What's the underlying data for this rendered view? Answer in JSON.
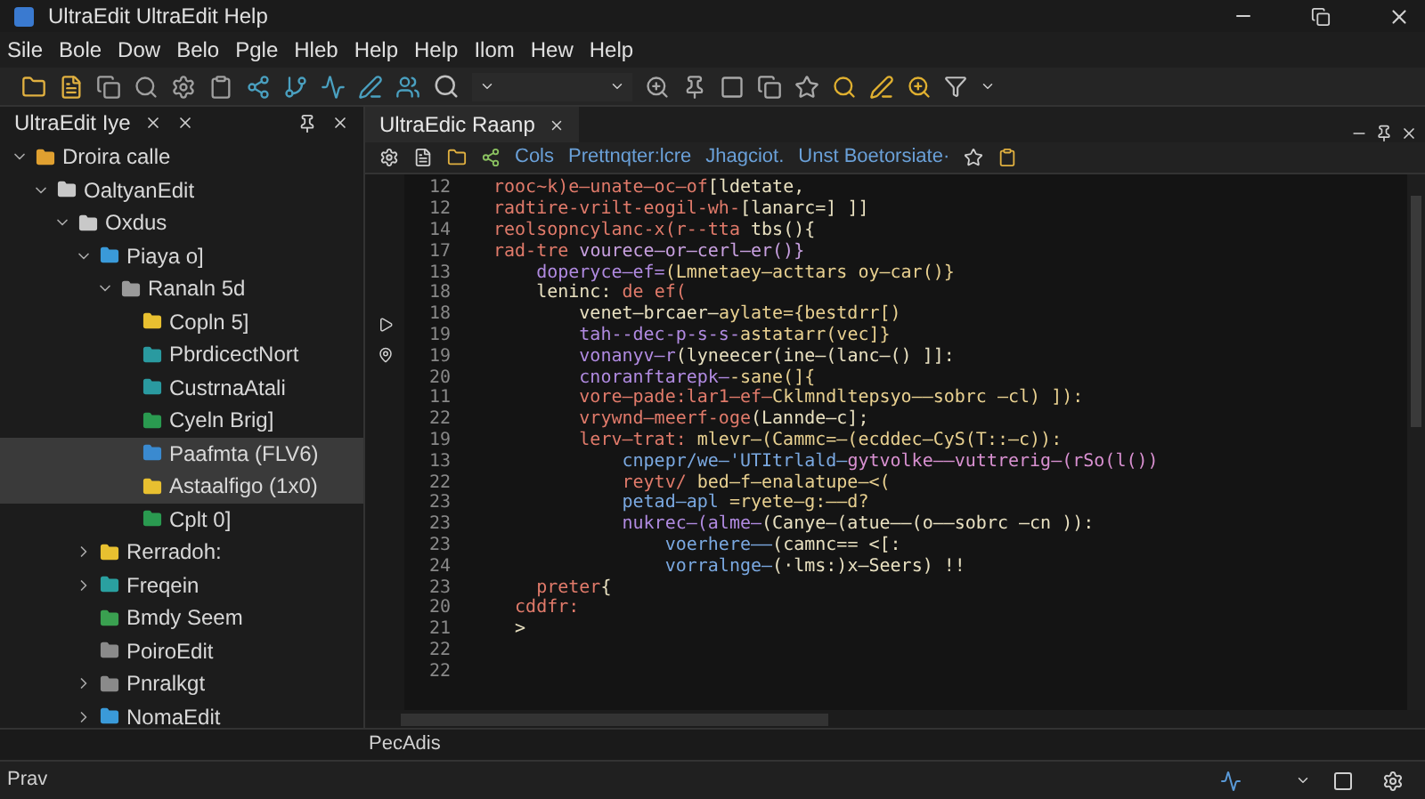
{
  "window": {
    "title": "UltraEdit UltraEdit Help"
  },
  "menu": [
    "Sile",
    "Bole",
    "Dow",
    "Belo",
    "Pgle",
    "Hleb",
    "Help",
    "Help",
    "Ilom",
    "Hew",
    "Help"
  ],
  "explorer": {
    "tab": "UltraEdit Iye",
    "tree": [
      {
        "label": "Droira calle",
        "color": "#e0a030",
        "expanded": true,
        "selected": false,
        "children": [
          {
            "label": "OaltyanEdit",
            "color": "#c8c8c8",
            "expanded": true,
            "selected": false,
            "children": [
              {
                "label": "Oxdus",
                "color": "#c8c8c8",
                "expanded": true,
                "selected": false,
                "children": [
                  {
                    "label": "Piaya o]",
                    "color": "#3a9ad9",
                    "expanded": true,
                    "selected": false,
                    "children": [
                      {
                        "label": "Ranaln 5d",
                        "color": "#9a9a9a",
                        "expanded": true,
                        "selected": false,
                        "children": [
                          {
                            "label": "Copln 5]",
                            "color": "#e8c030",
                            "selected": false
                          },
                          {
                            "label": "PbrdicectNort",
                            "color": "#2a9aa0",
                            "selected": false
                          },
                          {
                            "label": "CustrnaAtali",
                            "color": "#2a9aa0",
                            "selected": false
                          },
                          {
                            "label": "Cyeln Brig]",
                            "color": "#2a9a50",
                            "selected": false
                          },
                          {
                            "label": "Paafmta (FLV6)",
                            "color": "#3a8ad0",
                            "selected": true
                          },
                          {
                            "label": "Astaalfigo (1x0)",
                            "color": "#e8c030",
                            "selected": true
                          },
                          {
                            "label": "Cplt 0]",
                            "color": "#2a9a50",
                            "selected": false
                          }
                        ]
                      }
                    ]
                  },
                  {
                    "label": "Rerradoh:",
                    "color": "#e8c030",
                    "expanded": false,
                    "selected": false
                  },
                  {
                    "label": "Freqein",
                    "color": "#2aa0a0",
                    "expanded": false,
                    "selected": false
                  },
                  {
                    "label": "Bmdy Seem",
                    "color": "#3aa050",
                    "selected": false
                  },
                  {
                    "label": "PoiroEdit",
                    "color": "#8a8a8a",
                    "selected": false
                  },
                  {
                    "label": "Pnralkgt",
                    "color": "#8a8a8a",
                    "expanded": false,
                    "selected": false
                  },
                  {
                    "label": "NomaEdit",
                    "color": "#3a9ad9",
                    "expanded": false,
                    "selected": false
                  }
                ]
              }
            ]
          }
        ]
      }
    ]
  },
  "editor": {
    "tab": "UltraEdic Raanp",
    "breadcrumbs": [
      "Cols",
      "Prettnqter:lcre",
      "Jhagciot.",
      "Unst Boetorsiate·"
    ],
    "lines": [
      {
        "number": "12",
        "segments": [
          {
            "text": "rooc~k)e–unate–oc–of",
            "color": "#e07a6a"
          },
          {
            "text": "[ldetate,",
            "color": "#e8e0c0"
          }
        ]
      },
      {
        "number": "12",
        "segments": [
          {
            "text": "radtire-vrilt-eogil-wh-",
            "color": "#e07a6a"
          },
          {
            "text": "[lanarc=] ]]",
            "color": "#e8e0c0"
          }
        ]
      },
      {
        "number": "14",
        "segments": [
          {
            "text": "reolsopncylanc-x(r--tta",
            "color": "#e07a6a"
          },
          {
            "text": " tbs(){",
            "color": "#e8e0c0"
          }
        ]
      },
      {
        "number": "17",
        "segments": [
          {
            "text": "rad-tre ",
            "color": "#e07a6a"
          },
          {
            "text": "vourece–or–cerl–er()}",
            "color": "#c8a0e0"
          }
        ]
      },
      {
        "number": "13",
        "segments": [
          {
            "text": "    doperyce–ef=",
            "color": "#b08ae0"
          },
          {
            "text": "(Lmnetaey–acttars oy–car()}",
            "color": "#e8d090"
          }
        ]
      },
      {
        "number": "18",
        "segments": [
          {
            "text": "    leninc:",
            "color": "#e8e0c0"
          },
          {
            "text": " de ef(",
            "color": "#e07a6a"
          }
        ]
      },
      {
        "number": "18",
        "segments": [
          {
            "text": "        venet–brcaer–",
            "color": "#e8e0c0"
          },
          {
            "text": "aylate={bestdrr[)",
            "color": "#e8d090"
          }
        ]
      },
      {
        "number": "19",
        "segments": [
          {
            "text": "        tah--dec-p-s-s-",
            "color": "#b08ae0"
          },
          {
            "text": "astatarr(vec]}",
            "color": "#e8d090"
          }
        ]
      },
      {
        "number": "19",
        "segments": [
          {
            "text": "        vonanyv–r",
            "color": "#b08ae0"
          },
          {
            "text": "(lyneecer(ine–(lanc–() ]]:",
            "color": "#e8e0c0"
          }
        ]
      },
      {
        "number": "20",
        "segments": [
          {
            "text": "        cnoranftarepk–",
            "color": "#b08ae0"
          },
          {
            "text": "-sane(]{",
            "color": "#e8d090"
          }
        ]
      },
      {
        "number": "11",
        "segments": [
          {
            "text": "        vore–pade:lar1–ef–",
            "color": "#e07a6a"
          },
          {
            "text": "Cklmndltepsyo––sobrc –cl) ]):",
            "color": "#e8d090"
          }
        ]
      },
      {
        "number": "22",
        "segments": [
          {
            "text": "        vrywnd–meerf-oge",
            "color": "#e07a6a"
          },
          {
            "text": "(Lannde–c];",
            "color": "#e8e0c0"
          }
        ]
      },
      {
        "number": "19",
        "segments": [
          {
            "text": "        lerv–trat: ",
            "color": "#e07a6a"
          },
          {
            "text": "mlevr–(Cammc=–(ecddec–CyS(T::–c)):",
            "color": "#e8d090"
          }
        ]
      },
      {
        "number": "13",
        "segments": [
          {
            "text": "            cnpepr/we–'UTItrlald–",
            "color": "#7aa8e0"
          },
          {
            "text": "gytvolke––vuttrerig–(rSo(l())",
            "color": "#d890d0"
          }
        ]
      },
      {
        "number": "22",
        "segments": [
          {
            "text": "            reytv/ ",
            "color": "#e07a6a"
          },
          {
            "text": "bed–f–enalatupe–<(",
            "color": "#e8d090"
          }
        ]
      },
      {
        "number": "23",
        "segments": [
          {
            "text": "            petad–apl",
            "color": "#7aa8e0"
          },
          {
            "text": " =ryete–g:––d?",
            "color": "#e8d090"
          }
        ]
      },
      {
        "number": "23",
        "segments": [
          {
            "text": "            nukrec–(alme–",
            "color": "#b08ae0"
          },
          {
            "text": "(Canye–(atue––(o––sobrc –cn )):",
            "color": "#e8e0c0"
          }
        ]
      },
      {
        "number": "23",
        "segments": [
          {
            "text": "                voerhere––",
            "color": "#7aa8e0"
          },
          {
            "text": "(camnc== <[:",
            "color": "#e8e0c0"
          }
        ]
      },
      {
        "number": "24",
        "segments": [
          {
            "text": "                vorralnge–",
            "color": "#7aa8e0"
          },
          {
            "text": "(·lms:)x–Seers) !!",
            "color": "#e8e0c0"
          }
        ]
      },
      {
        "number": "23",
        "segments": [
          {
            "text": "    preter",
            "color": "#e07a6a"
          },
          {
            "text": "{",
            "color": "#e8e0c0"
          }
        ]
      },
      {
        "number": "20",
        "segments": [
          {
            "text": "  cddfr:",
            "color": "#e07a6a"
          }
        ]
      },
      {
        "number": "21",
        "segments": [
          {
            "text": "  >",
            "color": "#e8e0c0"
          }
        ]
      },
      {
        "number": "22"
      },
      {
        "number": "22"
      }
    ]
  },
  "bottom_panel": {
    "tab": "PecAdis"
  },
  "status_bar": {
    "text": "Prav"
  }
}
